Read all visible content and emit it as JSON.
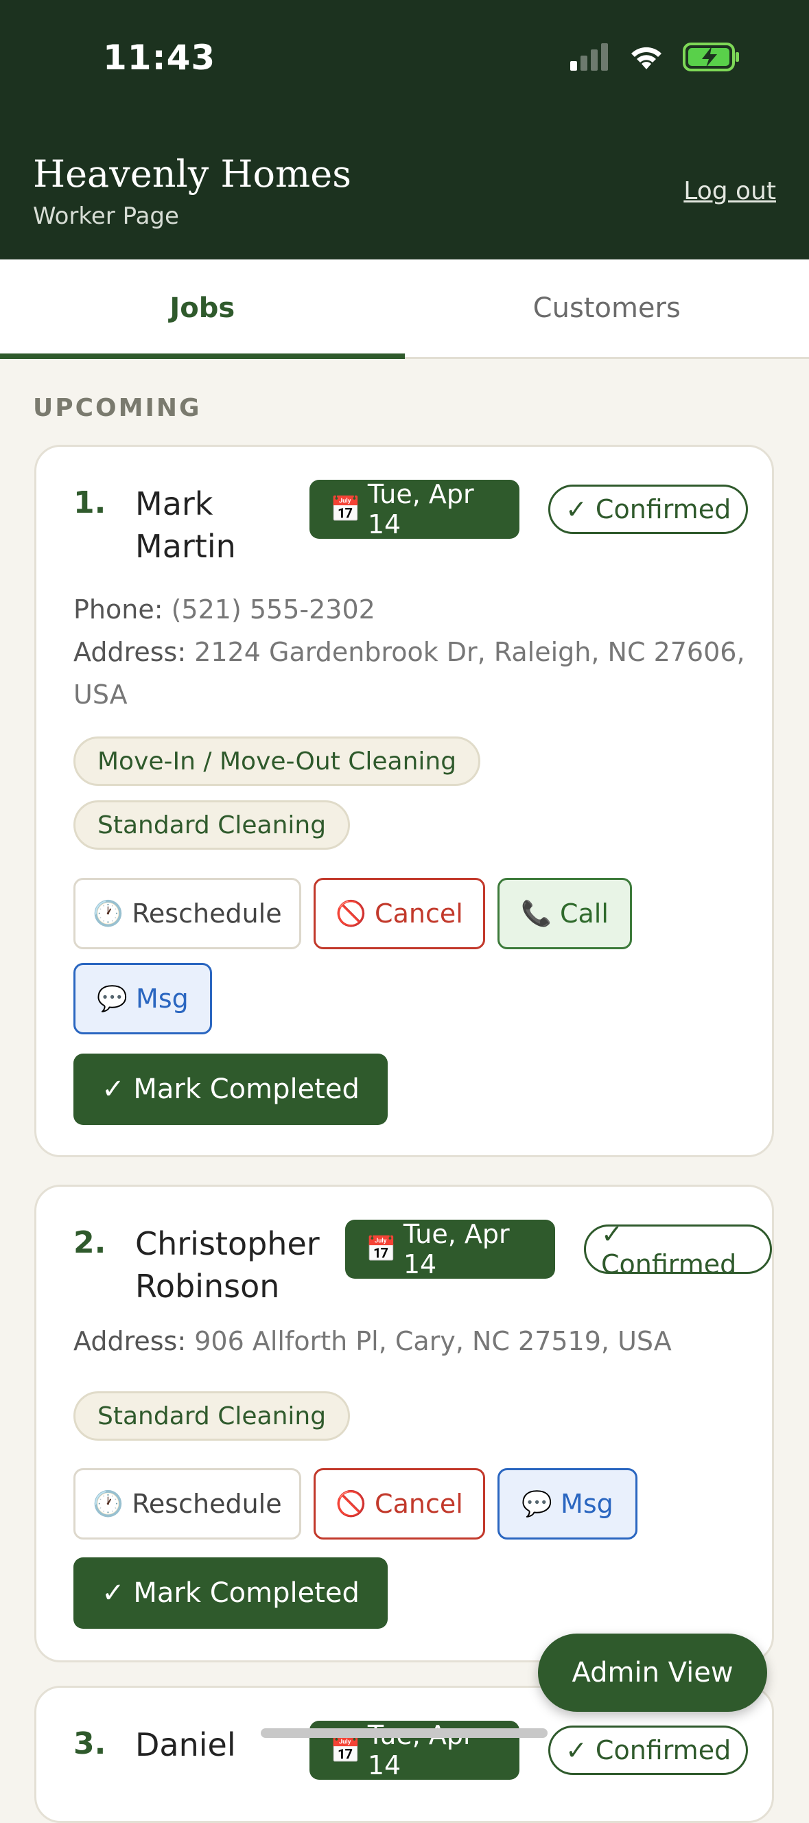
{
  "status_bar": {
    "time": "11:43"
  },
  "header": {
    "title": "Heavenly Homes",
    "subtitle": "Worker Page",
    "logout": "Log out"
  },
  "tabs": [
    {
      "label": "Jobs",
      "active": true
    },
    {
      "label": "Customers",
      "active": false
    }
  ],
  "section_label": "UPCOMING",
  "jobs": [
    {
      "number": "1.",
      "first_name": "Mark",
      "last_name": "Martin",
      "date": "Tue, Apr 14",
      "status": "✓ Confirmed",
      "phone_label": "Phone:",
      "phone": "(521) 555-2302",
      "address_label": "Address:",
      "address_line1": "2124 Gardenbrook Dr, Raleigh, NC 27606,",
      "address_line2": "USA",
      "services": [
        "Move-In / Move-Out Cleaning",
        "Standard Cleaning"
      ],
      "actions": {
        "reschedule": "Reschedule",
        "cancel": "Cancel",
        "call": "Call",
        "msg": "Msg",
        "complete": "✓ Mark Completed"
      }
    },
    {
      "number": "2.",
      "first_name": "Christopher",
      "last_name": "Robinson",
      "date": "Tue, Apr 14",
      "status": "✓ Confirmed",
      "address_label": "Address:",
      "address_line1": "906 Allforth Pl, Cary, NC 27519, USA",
      "services": [
        "Standard Cleaning"
      ],
      "actions": {
        "reschedule": "Reschedule",
        "cancel": "Cancel",
        "msg": "Msg",
        "complete": "✓ Mark Completed"
      }
    },
    {
      "number": "3.",
      "first_name": "Daniel",
      "date": "Tue, Apr 14",
      "status": "✓ Confirmed"
    }
  ],
  "fab_label": "Admin View",
  "colors": {
    "header_bg": "#1c321f",
    "accent": "#2f5a2c",
    "cancel": "#c2392b",
    "msg": "#2a66c0"
  }
}
